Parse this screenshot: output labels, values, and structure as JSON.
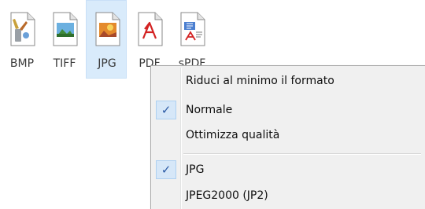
{
  "formats": [
    {
      "label": "BMP",
      "icon": "bmp-file-icon",
      "selected": false
    },
    {
      "label": "TIFF",
      "icon": "tiff-file-icon",
      "selected": false
    },
    {
      "label": "JPG",
      "icon": "jpg-file-icon",
      "selected": true
    },
    {
      "label": "PDF",
      "icon": "pdf-file-icon",
      "selected": false
    },
    {
      "label": "sPDF",
      "icon": "spdf-file-icon",
      "selected": false
    }
  ],
  "menu": {
    "items": [
      {
        "label": "Riduci al minimo il formato",
        "checked": false
      },
      {
        "label": "Normale",
        "checked": true
      },
      {
        "label": "Ottimizza qualità",
        "checked": false
      },
      {
        "label": "JPG",
        "checked": true
      },
      {
        "label": "JPEG2000 (JP2)",
        "checked": false
      }
    ]
  },
  "colors": {
    "selected_bg": "#d9ebfb",
    "menu_bg": "#f0f0f0",
    "check_bg": "#d6e7f8",
    "check_mark": "#2b5aa5"
  }
}
